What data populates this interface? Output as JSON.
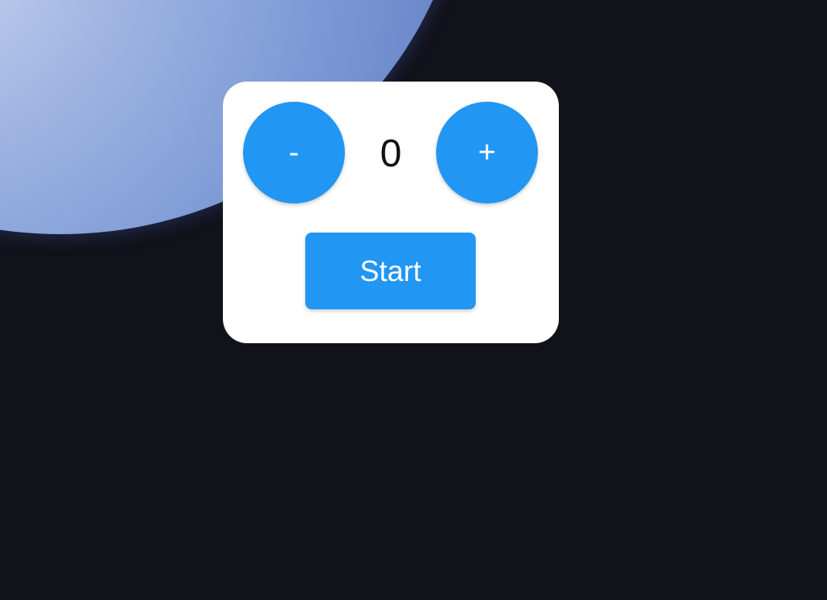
{
  "counter": {
    "decrement_label": "-",
    "value": "0",
    "increment_label": "+"
  },
  "start_button": {
    "label": "Start"
  },
  "colors": {
    "accent": "#2196f3",
    "card_background": "#ffffff",
    "desktop_background": "#12121b"
  }
}
